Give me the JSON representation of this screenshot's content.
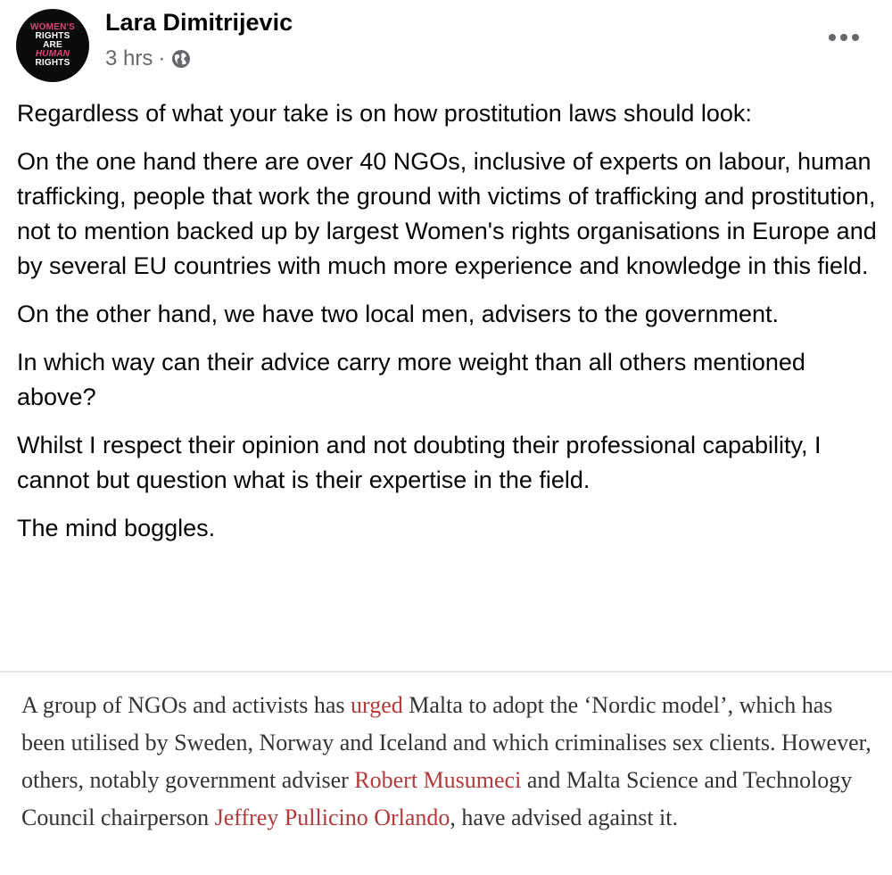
{
  "post": {
    "author": "Lara Dimitrijevic",
    "avatar_text": [
      "WOMEN'S",
      "RIGHTS",
      "ARE",
      "HUMAN",
      "RIGHTS"
    ],
    "time": "3 hrs",
    "separator": "·",
    "privacy_icon": "globe-icon",
    "more_icon": "more-options-icon",
    "paragraphs": [
      "Regardless of what your take is on how prostitution laws should look:",
      "On the one hand there are over 40 NGOs, inclusive of experts on labour, human trafficking, people that work the ground with victims of trafficking and prostitution, not to mention backed up by largest Women's rights organisations in Europe and by several EU countries with much more experience and knowledge in this field.",
      "On the other hand, we have two local men, advisers to the government.",
      "In which way can their advice carry more weight than all others mentioned above?",
      "Whilst I respect their opinion and not doubting their professional capability,  I cannot but question what is their expertise in the field.",
      "The mind boggles."
    ]
  },
  "article": {
    "t1": "A group of NGOs and activists has ",
    "link1": "urged",
    "t2": " Malta to adopt the ‘Nordic model’, which has been utilised by Sweden, Norway and Iceland and which criminalises sex clients. However, others, notably government adviser ",
    "link2": "Robert Musumeci",
    "t3": " and Malta Science and Technology Council chairperson ",
    "link3": "Jeffrey Pullicino Orlando",
    "t4": ", have advised against it."
  },
  "colors": {
    "link": "#b33a3a",
    "avatar_pink": "#e0457b",
    "meta_gray": "#65676b"
  }
}
